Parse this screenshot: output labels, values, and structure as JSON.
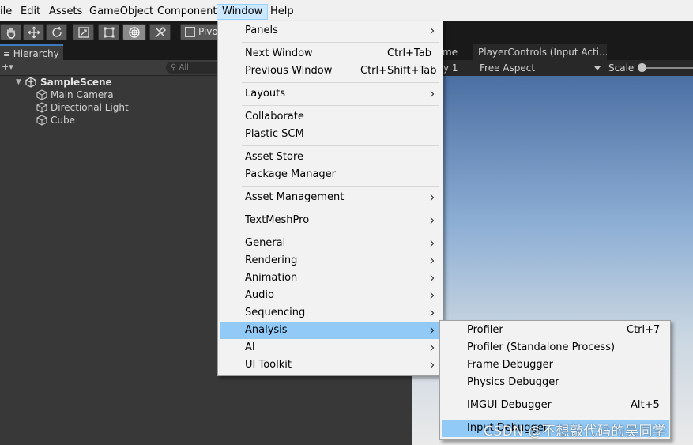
{
  "menubar": {
    "items": [
      {
        "label": "ile"
      },
      {
        "label": "Edit"
      },
      {
        "label": "Assets"
      },
      {
        "label": "GameObject"
      },
      {
        "label": "Component"
      },
      {
        "label": "Window"
      },
      {
        "label": "Help"
      }
    ]
  },
  "toolbar": {
    "tools": [
      "hand-tool-icon",
      "move-tool-icon",
      "rotate-tool-icon",
      "scale-tool-icon",
      "rect-tool-icon",
      "transform-tool-icon",
      "custom-tool-icon"
    ],
    "pivot_label": "Pivo"
  },
  "hierarchy": {
    "tab_label": "Hierarchy",
    "search_placeholder": "All",
    "scene_name": "SampleScene",
    "objects": [
      "Main Camera",
      "Directional Light",
      "Cube"
    ]
  },
  "game_view": {
    "tab_fragment": "me",
    "display_fragment": "y 1",
    "aspect": "Free Aspect",
    "scale_label": "Scale",
    "other_tab": "PlayerControls (Input Acti..."
  },
  "window_menu": {
    "items": [
      {
        "label": "Panels",
        "submenu": true
      },
      {
        "label": "Next Window",
        "shortcut": "Ctrl+Tab"
      },
      {
        "label": "Previous Window",
        "shortcut": "Ctrl+Shift+Tab"
      },
      {
        "label": "Layouts",
        "submenu": true
      },
      {
        "label": "Collaborate"
      },
      {
        "label": "Plastic SCM"
      },
      {
        "label": "Asset Store"
      },
      {
        "label": "Package Manager"
      },
      {
        "label": "Asset Management",
        "submenu": true
      },
      {
        "label": "TextMeshPro",
        "submenu": true
      },
      {
        "label": "General",
        "submenu": true
      },
      {
        "label": "Rendering",
        "submenu": true
      },
      {
        "label": "Animation",
        "submenu": true
      },
      {
        "label": "Audio",
        "submenu": true
      },
      {
        "label": "Sequencing",
        "submenu": true
      },
      {
        "label": "Analysis",
        "submenu": true,
        "highlighted": true
      },
      {
        "label": "AI",
        "submenu": true
      },
      {
        "label": "UI Toolkit",
        "submenu": true
      }
    ]
  },
  "analysis_menu": {
    "items": [
      {
        "label": "Profiler",
        "shortcut": "Ctrl+7"
      },
      {
        "label": "Profiler (Standalone Process)"
      },
      {
        "label": "Frame Debugger"
      },
      {
        "label": "Physics Debugger"
      },
      {
        "label": "IMGUI Debugger",
        "shortcut": "Alt+5"
      },
      {
        "label": "Input Debugger",
        "highlighted": true
      }
    ]
  },
  "watermark": "CSDN @不想敲代码的吴同学",
  "colors": {
    "menu_highlight": "#91c9f7",
    "menubar_active": "#cce8ff",
    "editor_dark": "#383838",
    "toolbar_bg": "#191919"
  }
}
